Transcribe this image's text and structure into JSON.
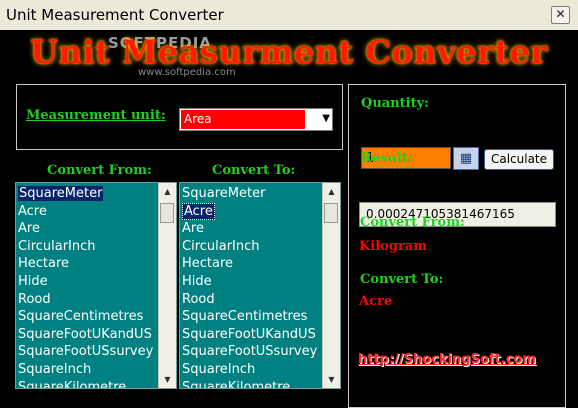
{
  "window": {
    "title": "Unit Measurement Converter",
    "close_glyph": "✕"
  },
  "banner": {
    "title": "Unit Measurment Converter",
    "watermark": "SOFTPEDIA",
    "watermark_url": "www.softpedia.com"
  },
  "unit": {
    "label": "Measurement unit:",
    "selected": "Area"
  },
  "convert_from_header": "Convert From:",
  "convert_to_header": "Convert To:",
  "from_list": {
    "items": [
      "SquareMeter",
      "Acre",
      "Are",
      "CircularInch",
      "Hectare",
      "Hide",
      "Rood",
      "SquareCentimetres",
      "SquareFootUKandUS",
      "SquareFootUSsurvey",
      "SquareInch",
      "SquareKilometre"
    ],
    "selected_index": 0
  },
  "to_list": {
    "items": [
      "SquareMeter",
      "Acre",
      "Are",
      "CircularInch",
      "Hectare",
      "Hide",
      "Rood",
      "SquareCentimetres",
      "SquareFootUKandUS",
      "SquareFootUSsurvey",
      "SquareInch",
      "SquareKilometre"
    ],
    "selected_index": 1
  },
  "quantity": {
    "label": "Quantity:",
    "value": "1"
  },
  "calculate_label": "Calculate",
  "result": {
    "label": "Result:",
    "value": "0.000247105381467165"
  },
  "summary": {
    "from_label": "Convert From:",
    "from_value": "Kilogram",
    "to_label": "Convert To:",
    "to_value": "Acre"
  },
  "link": "http://ShockingSoft.com",
  "colors": {
    "accent_green": "#1fd11f",
    "list_bg": "#008080",
    "unit_field": "#ff0000",
    "quantity_field": "#ff8000",
    "summary_value": "#ff0000"
  }
}
